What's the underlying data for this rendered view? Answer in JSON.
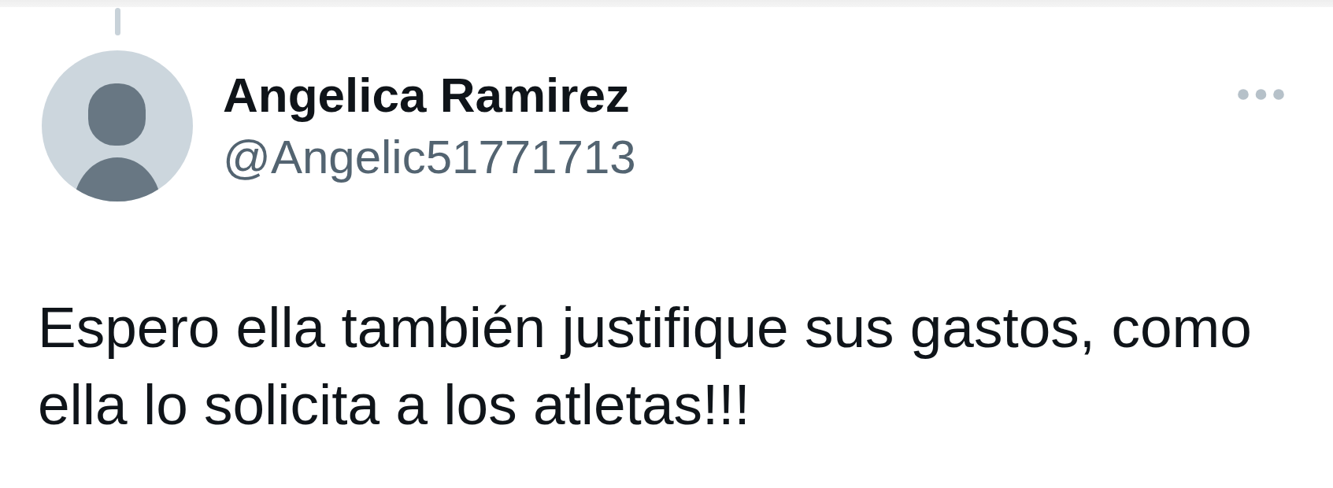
{
  "author": {
    "name": "Angelica Ramirez",
    "handle": "@Angelic51771713"
  },
  "post": {
    "text": "Espero ella también justifique sus gastos, como ella lo solicita a los atletas!!!"
  }
}
